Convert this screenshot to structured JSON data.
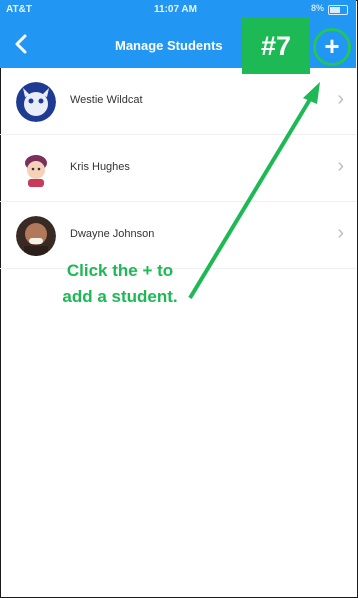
{
  "status_bar": {
    "carrier": "AT&T",
    "time": "11:07 AM",
    "battery": "8%"
  },
  "header": {
    "title": "Manage Students",
    "back_icon": "chevron-left-icon",
    "add_icon": "plus-icon"
  },
  "annotation": {
    "step": "#7",
    "caption_line1": "Click the + to",
    "caption_line2": "add a student."
  },
  "students": [
    {
      "name": "Westie Wildcat",
      "avatar": "wildcat-mascot-avatar"
    },
    {
      "name": "Kris Hughes",
      "avatar": "cartoon-avatar"
    },
    {
      "name": "Dwayne Johnson",
      "avatar": "photo-avatar"
    }
  ],
  "colors": {
    "header_bg": "#2196f3",
    "annotation_green": "#1db954"
  }
}
